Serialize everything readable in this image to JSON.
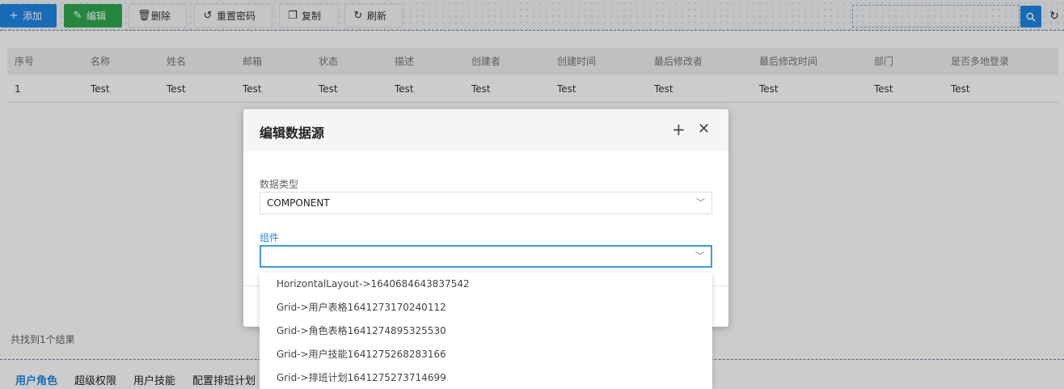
{
  "toolbar": {
    "add": "添加",
    "edit": "编辑",
    "delete": "删除",
    "reset_password": "重置密码",
    "copy": "复制",
    "refresh": "刷新"
  },
  "table": {
    "headers": [
      "序号",
      "名称",
      "姓名",
      "邮箱",
      "状态",
      "描述",
      "创建者",
      "创建时间",
      "最后修改者",
      "最后修改时间",
      "部门",
      "是否多地登录"
    ],
    "rows": [
      [
        "1",
        "Test",
        "Test",
        "Test",
        "Test",
        "Test",
        "Test",
        "Test",
        "Test",
        "Test",
        "Test",
        "Test"
      ]
    ]
  },
  "result_count": "共找到1个结果",
  "bottom_tabs": [
    "用户角色",
    "超级权限",
    "用户技能",
    "配置排班计划"
  ],
  "modal": {
    "title": "编辑数据源",
    "data_type_label": "数据类型",
    "data_type_value": "COMPONENT",
    "component_label": "组件",
    "component_value": ""
  },
  "dropdown_options": [
    "HorizontalLayout->1640684643837542",
    "Grid->用户表格1641273170240112",
    "Grid->角色表格1641274895325530",
    "Grid->用户技能1641275268283166",
    "Grid->排班计划1641275273714699"
  ],
  "colors": {
    "primary": "#1e88e5",
    "success": "#2fa84f"
  }
}
